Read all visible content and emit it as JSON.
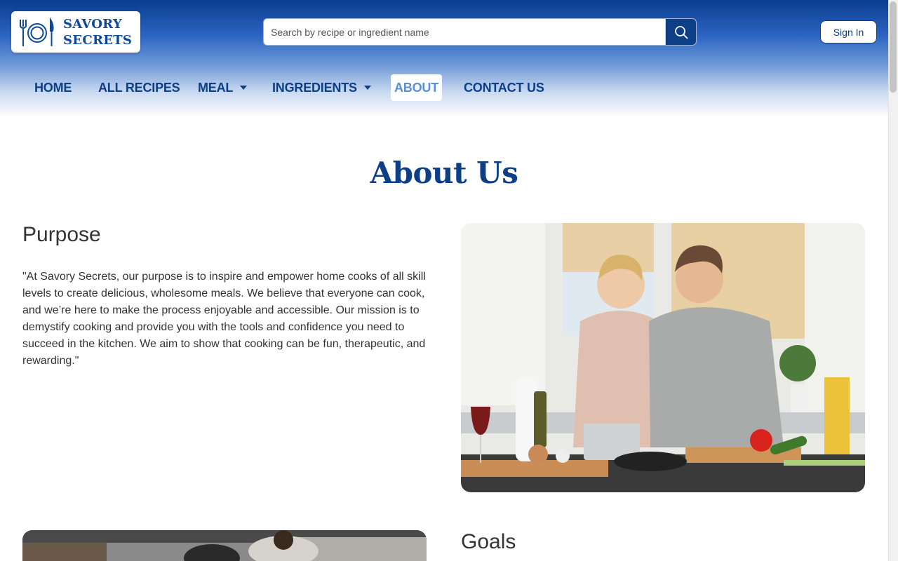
{
  "brand": {
    "name_line1": "SAVORY",
    "name_line2": "SECRETS"
  },
  "search": {
    "placeholder": "Search by recipe or ingredient name",
    "icon": "search-icon"
  },
  "auth": {
    "signin_label": "Sign In"
  },
  "nav": {
    "home": "HOME",
    "all_recipes": "ALL RECIPES",
    "meal": "MEAL",
    "ingredients": "INGREDIENTS",
    "about": "ABOUT",
    "contact": "CONTACT US",
    "active": "ABOUT"
  },
  "page": {
    "title": "About Us"
  },
  "purpose": {
    "heading": "Purpose",
    "text": "\"At Savory Secrets, our purpose is to inspire and empower home cooks of all skill levels to create delicious, wholesome meals. We believe that everyone can cook, and we’re here to make the process enjoyable and accessible. Our mission is to demystify cooking and provide you with the tools and confidence you need to succeed in the kitchen. We aim to show that cooking can be fun, therapeutic, and rewarding.\""
  },
  "goals": {
    "heading": "Goals"
  },
  "colors": {
    "brand_blue": "#0d3f86",
    "active_nav": "#5b8fd4"
  }
}
